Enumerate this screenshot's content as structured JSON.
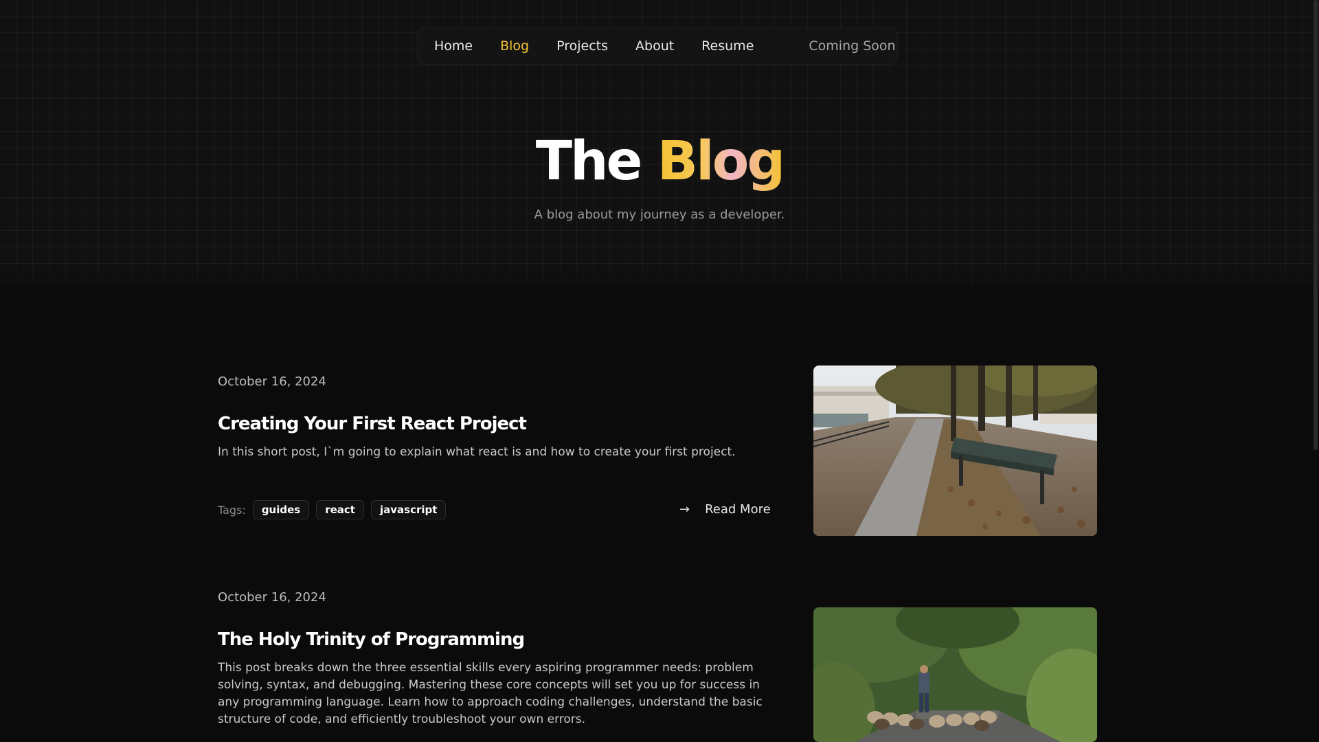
{
  "nav": {
    "items": [
      {
        "label": "Home",
        "active": false
      },
      {
        "label": "Blog",
        "active": true
      },
      {
        "label": "Projects",
        "active": false
      },
      {
        "label": "About",
        "active": false
      },
      {
        "label": "Resume",
        "active": false
      }
    ],
    "coming_soon": "Coming Soon"
  },
  "hero": {
    "title_part1": "The",
    "title_part2": "Blog",
    "subtitle": "A blog about my journey as a developer."
  },
  "posts": [
    {
      "date": "October 16, 2024",
      "title": "Creating Your First React Project",
      "description": "In this short post, I`m going to explain what react is and how to create your first project.",
      "tags_label": "Tags:",
      "tags": [
        "guides",
        "react",
        "javascript"
      ],
      "read_more": "Read More",
      "image": "autumn-park-bench"
    },
    {
      "date": "October 16, 2024",
      "title": "The Holy Trinity of Programming",
      "description": "This post breaks down the three essential skills every aspiring programmer needs: problem solving, syntax, and debugging. Mastering these core concepts will set you up for success in any programming language. Learn how to approach coding challenges, understand the basic structure of code, and efficiently troubleshoot your own errors.",
      "image": "shepherd-with-sheep-on-road"
    }
  ],
  "colors": {
    "accent": "#f4c430",
    "background": "#0b0b0b"
  },
  "icons": {
    "read_more": "arrow-right-icon"
  }
}
